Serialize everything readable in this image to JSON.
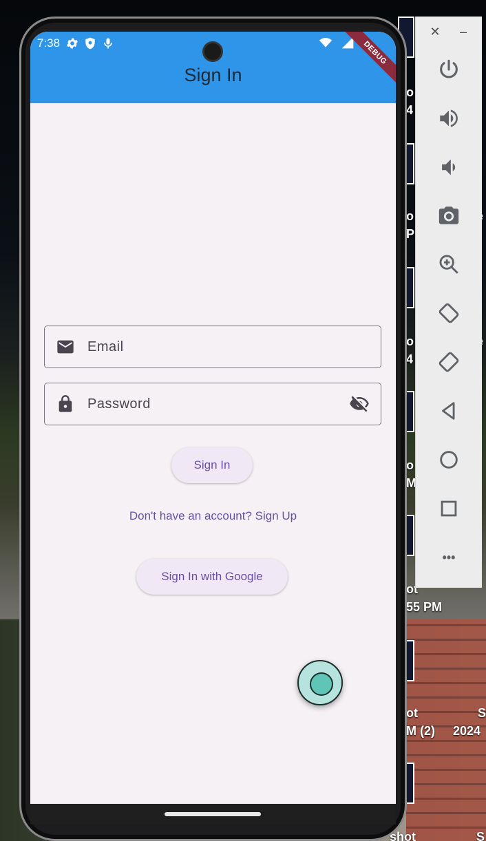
{
  "status_bar": {
    "time": "7:38"
  },
  "app_bar": {
    "title": "Sign In",
    "debug_banner": "DEBUG"
  },
  "form": {
    "email_placeholder": "Email",
    "password_placeholder": "Password"
  },
  "buttons": {
    "sign_in": "Sign In",
    "sign_up_link": "Don't have an account? Sign Up",
    "google": "Sign In with Google"
  },
  "desktop_labels": {
    "l1": "ot",
    "l2": "55 PM",
    "l3": "ot",
    "l4": "M (2)",
    "l5": "S",
    "l6": "2024",
    "l7": "shot",
    "l8": "S",
    "l9": "o",
    "l10": "4",
    "l11": "o",
    "l12": "PM",
    "l13": "e",
    "l14": "o",
    "l15": "4",
    "l16": "e",
    "l17": "o",
    "l18": "M"
  },
  "emulator_toolbar": {
    "close": "✕",
    "minimize": "–",
    "more": "•••"
  },
  "colors": {
    "app_bar": "#2f95e8",
    "screen_bg": "#f5f1f5",
    "accent_text": "#6650a4",
    "debug_ribbon": "#8d2b3e"
  },
  "icons": {
    "email_field": "email-icon",
    "password_field": "lock-icon",
    "visibility_toggle": "visibility-off-icon",
    "toolbar": [
      "power-icon",
      "volume-up-icon",
      "volume-down-icon",
      "camera-icon",
      "zoom-in-icon",
      "rotate-left-icon",
      "rotate-right-icon",
      "back-icon",
      "home-icon",
      "overview-icon",
      "more-icon"
    ]
  }
}
